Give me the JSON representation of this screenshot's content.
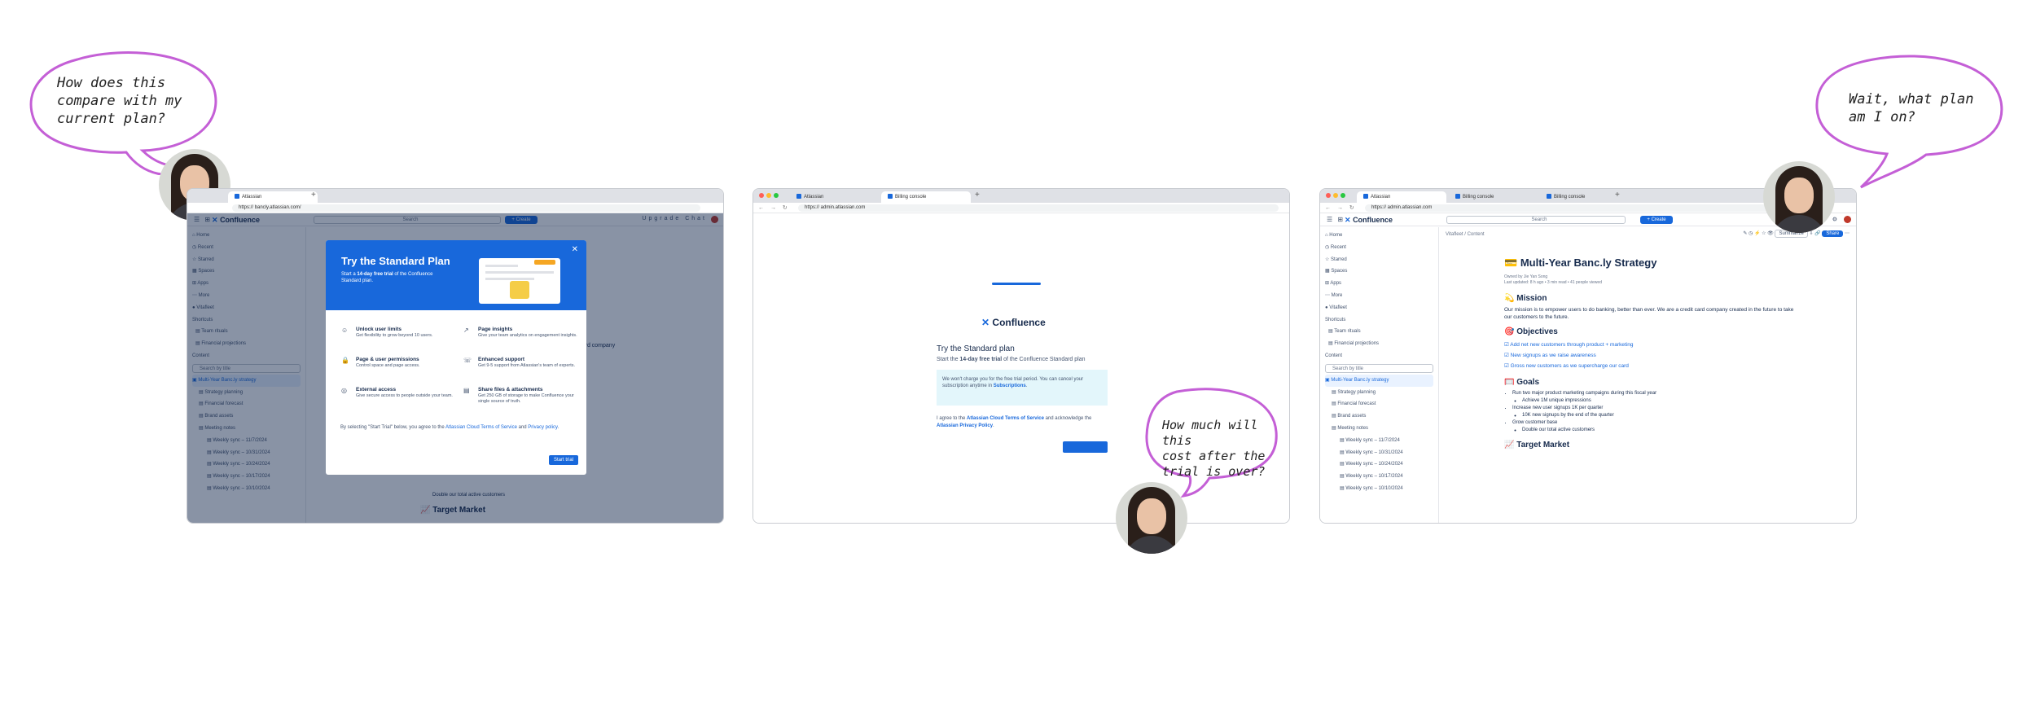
{
  "colors": {
    "accent": "#1868db",
    "bubble": "#c45fd6",
    "overlay": "#091e42"
  },
  "bubbles": [
    {
      "lines": [
        "How does this",
        "compare with my",
        "current plan?"
      ]
    },
    {
      "lines": [
        "How much will this",
        "cost after the",
        "trial is over?"
      ]
    },
    {
      "lines": [
        "Wait, what plan",
        "am I on?"
      ]
    }
  ],
  "win1": {
    "tabs": [
      "Atlassian"
    ],
    "url": "https:// bancly.atlassian.com/",
    "app": {
      "brand": "Confluence",
      "search": "Search",
      "create": "+ Create",
      "upgrade": "Upgrade",
      "chat": "Chat"
    },
    "sidebar": [
      "Home",
      "Recent",
      "Starred",
      "Spaces",
      "Apps",
      "More",
      "Vitafleet",
      "Shortcuts",
      "Team rituals",
      "Financial projections",
      "Content",
      "Search by title",
      "Multi-Year Banc.ly strategy",
      "Strategy planning",
      "Financial forecast",
      "Brand assets",
      "Meeting notes",
      "Weekly sync – 11/7/2024",
      "Weekly sync – 10/31/2024",
      "Weekly sync – 10/24/2024",
      "Weekly sync – 10/17/2024",
      "Weekly sync – 10/10/2024"
    ],
    "bg_text": [
      "edit card company",
      "Double our total active customers",
      "Target Market"
    ],
    "modal": {
      "title": "Try the Standard Plan",
      "subtitle_pre": "Start a ",
      "subtitle_bold": "14-day free trial",
      "subtitle_post": " of the Confluence Standard plan.",
      "features": [
        {
          "icon": "users-icon",
          "title": "Unlock user limits",
          "desc": "Get flexibility to grow beyond 10 users."
        },
        {
          "icon": "chart-icon",
          "title": "Page insights",
          "desc": "Give your team analytics on engagement insights."
        },
        {
          "icon": "lock-icon",
          "title": "Page & user permissions",
          "desc": "Control space and page access."
        },
        {
          "icon": "support-icon",
          "title": "Enhanced support",
          "desc": "Get 9-5 support from Atlassian's team of experts."
        },
        {
          "icon": "globe-icon",
          "title": "External access",
          "desc": "Give secure access to people outside your team."
        },
        {
          "icon": "file-icon",
          "title": "Share files & attachments",
          "desc": "Get 250 GB of storage to make Confluence your single source of truth."
        }
      ],
      "footer_pre": "By selecting \"Start Trial\" below, you agree to the ",
      "footer_link1": "Atlassian Cloud Terms of Service",
      "footer_mid": " and ",
      "footer_link2": "Privacy policy",
      "footer_end": ".",
      "start": "Start trial"
    }
  },
  "win2": {
    "tabs": [
      "Atlassian",
      "Billing console"
    ],
    "url": "https:// admin.atlassian.com",
    "brand": "Confluence",
    "title": "Try the Standard plan",
    "para_pre": "Start the ",
    "para_bold": "14-day free trial",
    "para_post": " of the Confluence Standard plan",
    "info_pre": "We won't charge you for the free trial period. You can cancel your subscription anytime in ",
    "info_link": "Subscriptions",
    "info_end": ".",
    "agree_pre": "I agree to the ",
    "agree_link1": "Atlassian Cloud Terms of Service",
    "agree_mid": " and acknowledge the ",
    "agree_link2": "Atlassian Privacy Policy",
    "agree_end": "."
  },
  "win3": {
    "tabs": [
      "Atlassian",
      "Billing console",
      "Billing console"
    ],
    "url": "https:// admin.atlassian.com",
    "app": {
      "brand": "Confluence",
      "search": "Search",
      "create": "+ Create",
      "summarize": "Summarize",
      "share": "Share"
    },
    "breadcrumb": "Vitafleet  /  Content",
    "sidebar": [
      "Home",
      "Recent",
      "Starred",
      "Spaces",
      "Apps",
      "More",
      "Vitafleet",
      "Shortcuts",
      "Team rituals",
      "Financial projections",
      "Content",
      "Search by title",
      "Multi-Year Banc.ly strategy",
      "Strategy planning",
      "Financial forecast",
      "Brand assets",
      "Meeting notes",
      "Weekly sync – 11/7/2024",
      "Weekly sync – 10/31/2024",
      "Weekly sync – 10/24/2024",
      "Weekly sync – 10/17/2024",
      "Weekly sync – 10/10/2024"
    ],
    "doc": {
      "title": "Multi-Year Banc.ly Strategy",
      "meta1": "Owned by Jie Yan Song",
      "meta2": "Last updated: 8 h ago • 3 min read • 41 people viewed",
      "mission_h": "Mission",
      "mission": "Our mission is to empower users to do banking, better than ever. We are a credit card company created in the future to take our customers to the future.",
      "objectives_h": "Objectives",
      "objectives": [
        "Add net new customers through product + marketing",
        "New signups as we raise awareness",
        "Gross new customers as we supercharge our card"
      ],
      "goals_h": "Goals",
      "goals": [
        "Run two major product marketing campaigns during this fiscal year",
        "Achieve 1M unique impressions",
        "Increase new user signups 1K per quarter",
        "10K new signups by the end of the quarter",
        "Grow customer base",
        "Double our total active customers"
      ],
      "target_h": "Target Market"
    }
  }
}
